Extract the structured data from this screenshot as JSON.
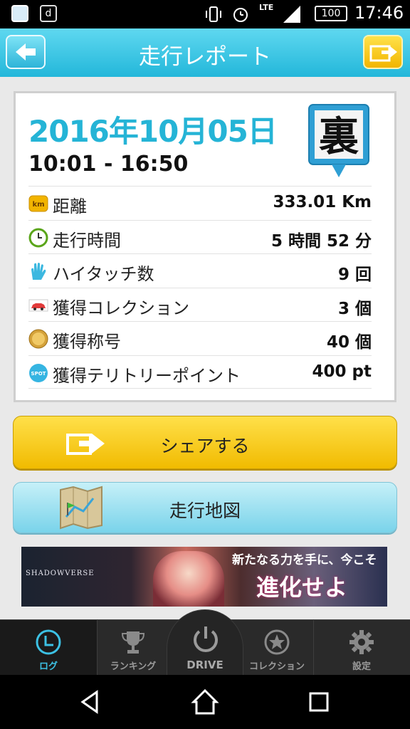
{
  "status_bar": {
    "notif_icon_2": "d",
    "network": "LTE",
    "battery": "100",
    "time": "17:46"
  },
  "header": {
    "title": "走行レポート"
  },
  "report": {
    "date": "2016年10月05日",
    "time_range": "10:01 - 16:50",
    "badge_char": "裏",
    "rows": [
      {
        "icon": "km-icon",
        "label": "距離",
        "value": "333.01 Km"
      },
      {
        "icon": "clock-icon",
        "label": "走行時間",
        "value": "5 時間 52 分"
      },
      {
        "icon": "high-five-icon",
        "label": "ハイタッチ数",
        "value": "9 回"
      },
      {
        "icon": "car-icon",
        "label": "獲得コレクション",
        "value": "3 個"
      },
      {
        "icon": "title-medal-icon",
        "label": "獲得称号",
        "value": "40 個"
      },
      {
        "icon": "spot-icon",
        "label": "獲得テリトリーポイント",
        "value": "400 pt"
      }
    ]
  },
  "buttons": {
    "share": "シェアする",
    "map": "走行地図"
  },
  "ad": {
    "brand": "SHADOWVERSE",
    "line1": "新たなる力を手に、今こそ",
    "line2": "進化せよ"
  },
  "bottom_nav": {
    "log": "ログ",
    "ranking": "ランキング",
    "drive": "DRIVE",
    "collection": "コレクション",
    "settings": "設定"
  },
  "colors": {
    "accent": "#25b4d6",
    "header": "#23b7da",
    "share_button": "#f1bb00",
    "map_button": "#79d3ea"
  }
}
